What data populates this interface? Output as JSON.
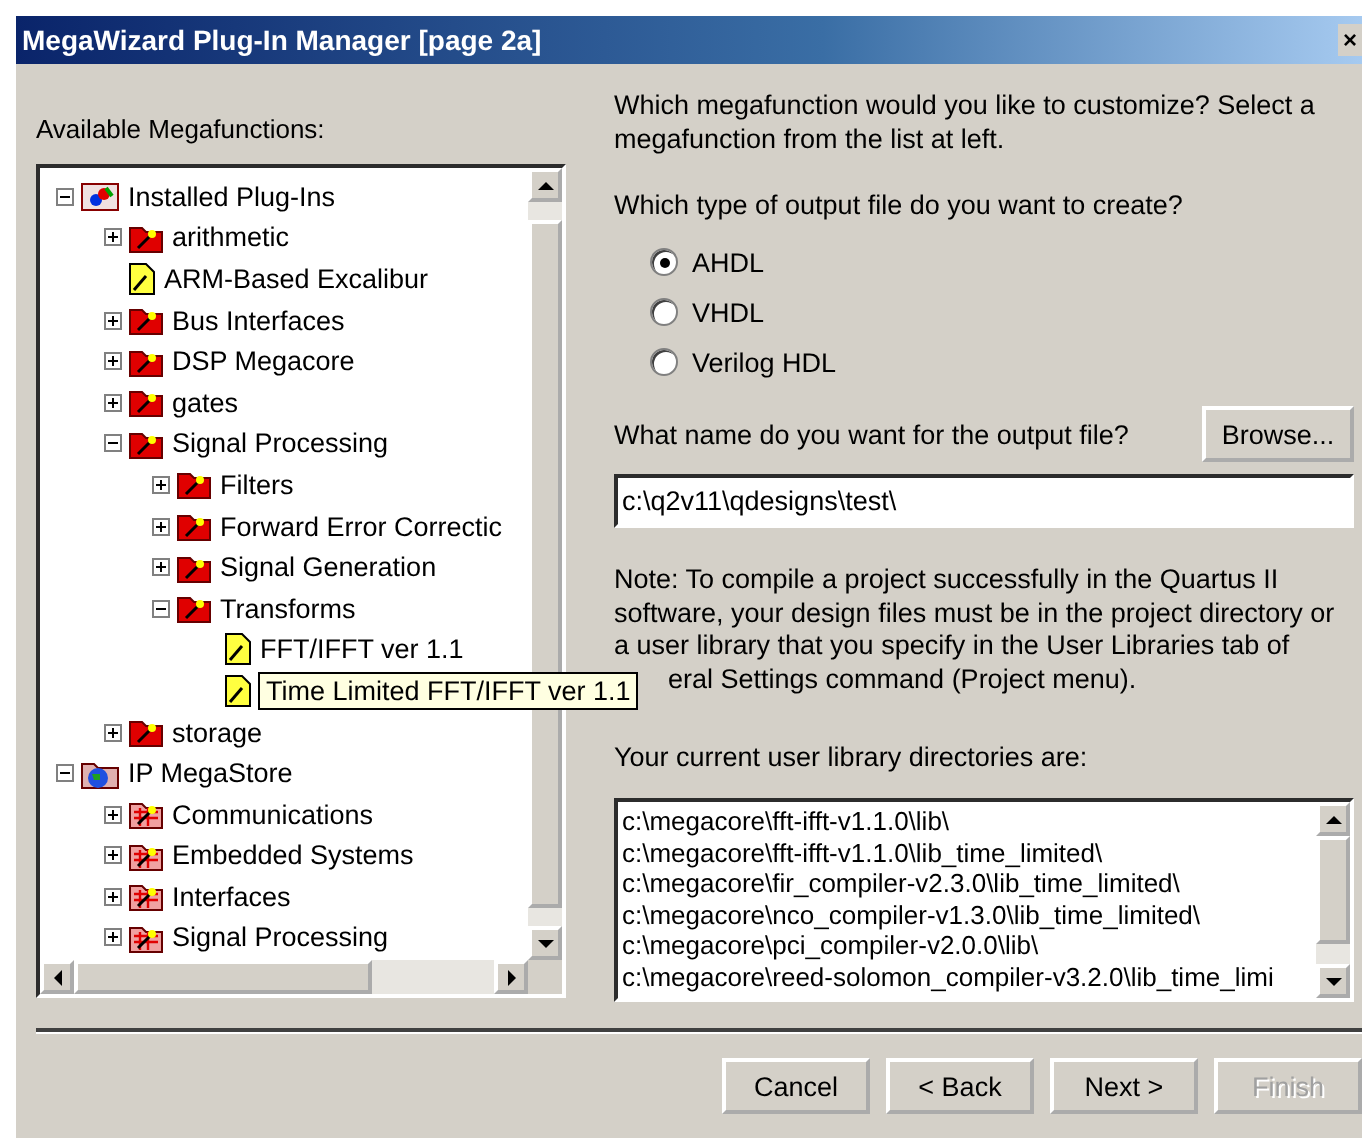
{
  "window": {
    "title": "MegaWizard Plug-In Manager [page 2a]",
    "close": "×"
  },
  "left": {
    "label": "Available Megafunctions:",
    "tree": [
      {
        "label": "Installed Plug-Ins",
        "kind": "plugins",
        "expanded": true,
        "children": [
          {
            "label": "arithmetic",
            "kind": "folder",
            "expanded": false
          },
          {
            "label": "ARM-Based Excalibur",
            "kind": "file"
          },
          {
            "label": "Bus Interfaces",
            "kind": "folder",
            "expanded": false
          },
          {
            "label": "DSP Megacore",
            "kind": "folder",
            "expanded": false
          },
          {
            "label": "gates",
            "kind": "folder",
            "expanded": false
          },
          {
            "label": "Signal Processing",
            "kind": "folder",
            "expanded": true,
            "children": [
              {
                "label": "Filters",
                "kind": "folder",
                "expanded": false
              },
              {
                "label": "Forward Error Correctic",
                "kind": "folder",
                "expanded": false
              },
              {
                "label": "Signal Generation",
                "kind": "folder",
                "expanded": false
              },
              {
                "label": "Transforms",
                "kind": "folder",
                "expanded": true,
                "children": [
                  {
                    "label": "FFT/IFFT ver 1.1",
                    "kind": "file",
                    "tooltip": false
                  },
                  {
                    "label": "Time Limited FFT/IFFT ver 1.1",
                    "kind": "file",
                    "tooltip": true
                  }
                ]
              }
            ]
          },
          {
            "label": "storage",
            "kind": "folder",
            "expanded": false
          }
        ]
      },
      {
        "label": "IP MegaStore",
        "kind": "store",
        "expanded": true,
        "children": [
          {
            "label": "Communications",
            "kind": "storefolder",
            "expanded": false
          },
          {
            "label": "Embedded Systems",
            "kind": "storefolder",
            "expanded": false
          },
          {
            "label": "Interfaces",
            "kind": "storefolder",
            "expanded": false
          },
          {
            "label": "Signal Processing",
            "kind": "storefolder",
            "expanded": false
          }
        ]
      }
    ]
  },
  "right": {
    "question": "Which megafunction would you like to customize? Select a megafunction from the list at left.",
    "type_label": "Which type of output file do you want to create?",
    "types": [
      {
        "label": "AHDL",
        "selected": true
      },
      {
        "label": "VHDL",
        "selected": false
      },
      {
        "label": "Verilog HDL",
        "selected": false
      }
    ],
    "name_label": "What name do you want for the output file?",
    "browse": "Browse...",
    "output_file": "c:\\q2v11\\qdesigns\\test\\",
    "note": [
      "Note: To compile a project successfully in the Quartus II",
      "software, your design files must be in the project directory or",
      "a user library that you specify in the User Libraries tab of",
      "eral Settings command (Project menu)."
    ],
    "libraries_label": "Your current user library directories are:",
    "libraries": [
      "c:\\megacore\\fft-ifft-v1.1.0\\lib\\",
      "c:\\megacore\\fft-ifft-v1.1.0\\lib_time_limited\\",
      "c:\\megacore\\fir_compiler-v2.3.0\\lib_time_limited\\",
      "c:\\megacore\\nco_compiler-v1.3.0\\lib_time_limited\\",
      "c:\\megacore\\pci_compiler-v2.0.0\\lib\\",
      "c:\\megacore\\reed-solomon_compiler-v3.2.0\\lib_time_limi"
    ]
  },
  "buttons": [
    {
      "label": "Cancel",
      "disabled": false
    },
    {
      "label": "< Back",
      "disabled": false
    },
    {
      "label": "Next >",
      "disabled": false
    },
    {
      "label": "Finish",
      "disabled": true
    }
  ]
}
